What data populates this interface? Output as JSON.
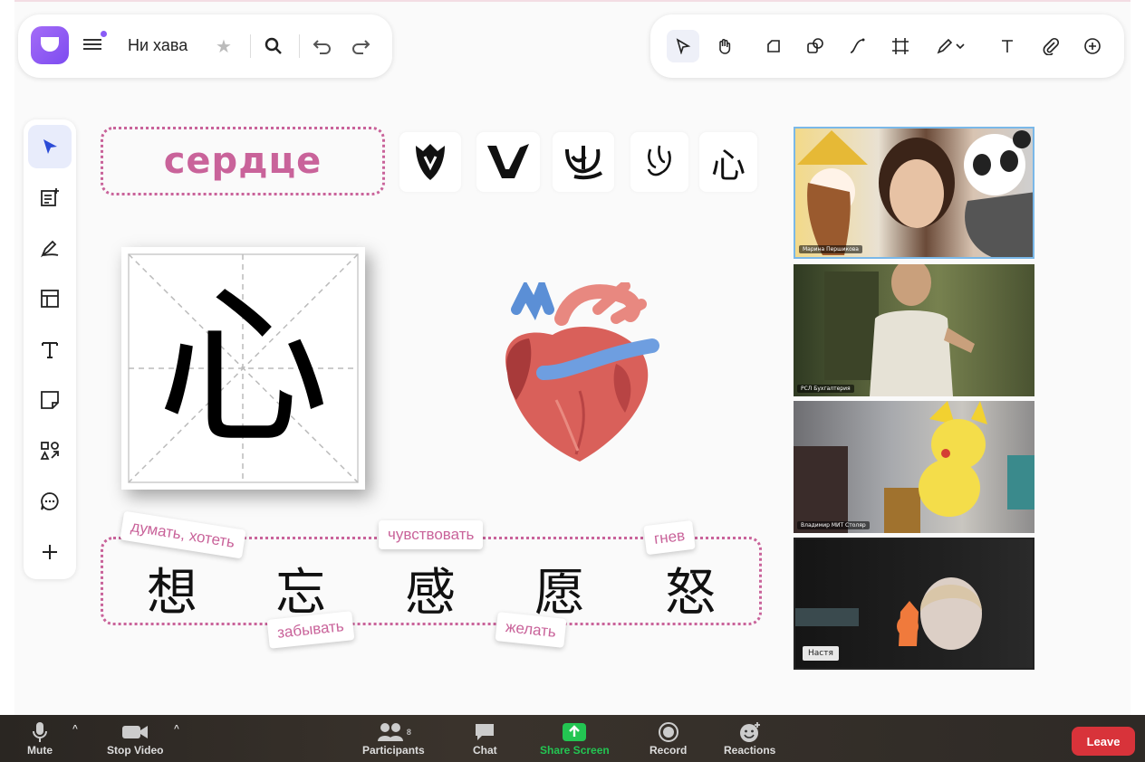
{
  "app": {
    "board_name": "Ни хава"
  },
  "toolbar_right": {
    "tools": [
      "select",
      "hand",
      "sticker",
      "shapes",
      "connector",
      "frame",
      "pen",
      "text",
      "attach",
      "add"
    ]
  },
  "side_toolbar": {
    "tools": [
      "pointer",
      "add-note",
      "draw",
      "layout",
      "text",
      "sticky-note",
      "shapes",
      "comment",
      "more"
    ]
  },
  "canvas": {
    "title": "сердце",
    "evolution_glyphs": [
      "心",
      "心",
      "心",
      "心",
      "心"
    ],
    "main_character": "心",
    "word_characters": [
      "想",
      "忘",
      "感",
      "愿",
      "怒"
    ],
    "tags": {
      "think_want": "думать, хотеть",
      "forget": "забывать",
      "feel": "чувствовать",
      "wish": "желать",
      "anger": "гнев"
    }
  },
  "participants": [
    {
      "label": "Марина Першикова"
    },
    {
      "label": "РСЛ Бухгалтерия"
    },
    {
      "label": "Владимир МИТ Столяр"
    },
    {
      "label": "Настя"
    }
  ],
  "meeting_bar": {
    "mute": "Mute",
    "stop_video": "Stop Video",
    "participants": "Participants",
    "participants_count": "8",
    "chat": "Chat",
    "share_screen": "Share Screen",
    "record": "Record",
    "reactions": "Reactions",
    "leave": "Leave"
  },
  "colors": {
    "accent": "#c9639a",
    "brand": "#8a5cf6",
    "share_green": "#23c552",
    "leave_red": "#d8333a"
  }
}
